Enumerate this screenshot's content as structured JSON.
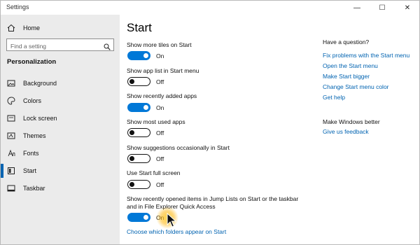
{
  "window": {
    "title": "Settings",
    "controls": {
      "minimize": "—",
      "maximize": "☐",
      "close": "✕"
    }
  },
  "sidebar": {
    "home_label": "Home",
    "search_placeholder": "Find a setting",
    "section_label": "Personalization",
    "items": [
      {
        "label": "Background",
        "icon": "image-icon"
      },
      {
        "label": "Colors",
        "icon": "palette-icon"
      },
      {
        "label": "Lock screen",
        "icon": "lock-screen-icon"
      },
      {
        "label": "Themes",
        "icon": "themes-icon"
      },
      {
        "label": "Fonts",
        "icon": "fonts-icon"
      },
      {
        "label": "Start",
        "icon": "start-icon",
        "active": true
      },
      {
        "label": "Taskbar",
        "icon": "taskbar-icon"
      }
    ]
  },
  "main": {
    "title": "Start",
    "settings": [
      {
        "label": "Show more tiles on Start",
        "state": "On",
        "on": true
      },
      {
        "label": "Show app list in Start menu",
        "state": "Off",
        "on": false
      },
      {
        "label": "Show recently added apps",
        "state": "On",
        "on": true
      },
      {
        "label": "Show most used apps",
        "state": "Off",
        "on": false
      },
      {
        "label": "Show suggestions occasionally in Start",
        "state": "Off",
        "on": false
      },
      {
        "label": "Use Start full screen",
        "state": "Off",
        "on": false
      },
      {
        "label_line1": "Show recently opened items in Jump Lists on Start or the taskbar",
        "label_line2": "and in File Explorer Quick Access",
        "state": "On",
        "on": true
      }
    ],
    "folders_link": "Choose which folders appear on Start"
  },
  "aside": {
    "question_heading": "Have a question?",
    "links": [
      "Fix problems with the Start menu",
      "Open the Start menu",
      "Make Start bigger",
      "Change Start menu color",
      "Get help"
    ],
    "better_heading": "Make Windows better",
    "feedback_link": "Give us feedback"
  },
  "colors": {
    "accent": "#0078d7",
    "link": "#0063b1",
    "sidebar_bg": "#ebebeb"
  }
}
